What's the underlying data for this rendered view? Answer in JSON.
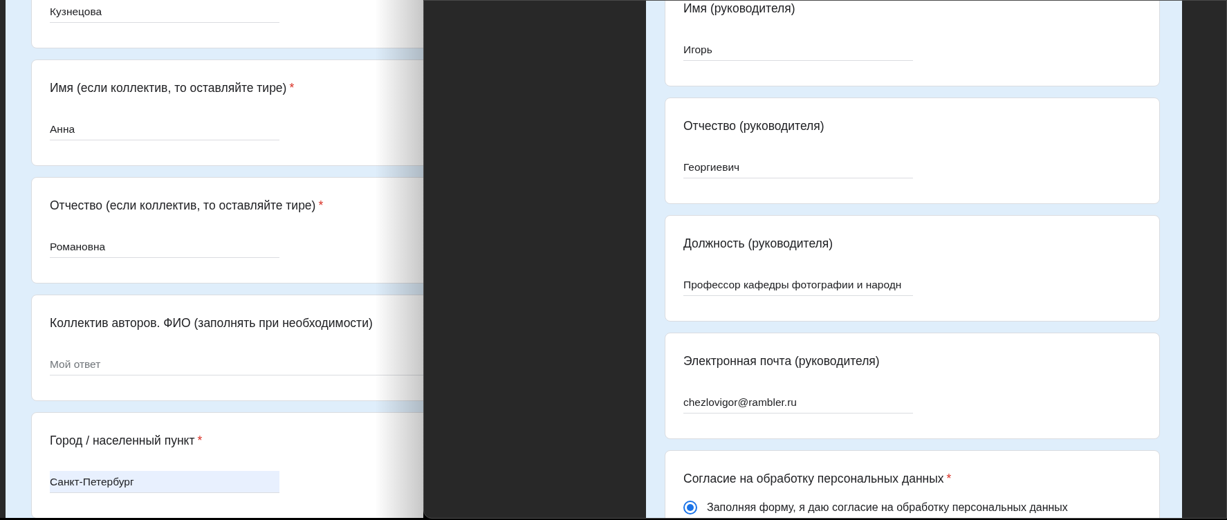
{
  "left_window": {
    "cards": [
      {
        "field": {
          "value": "Кузнецова",
          "highlighted": false
        }
      },
      {
        "question": "Имя (если коллектив, то оставляйте тире)",
        "required_mark": "*",
        "field": {
          "value": "Анна",
          "highlighted": false
        }
      },
      {
        "question": "Отчество (если коллектив, то оставляйте тире)",
        "required_mark": "*",
        "field": {
          "value": "Романовна",
          "highlighted": false
        }
      },
      {
        "question": "Коллектив авторов. ФИО (заполнять при необходимости)",
        "field": {
          "placeholder": "Мой ответ",
          "highlighted": false
        }
      },
      {
        "question": "Город / населенный пункт",
        "required_mark": "*",
        "field": {
          "value": "Санкт-Петербург",
          "highlighted": true
        }
      }
    ]
  },
  "right_window": {
    "cards": [
      {
        "question": "Имя (руководителя)",
        "field": {
          "value": "Игорь",
          "highlighted": false
        }
      },
      {
        "question": "Отчество (руководителя)",
        "field": {
          "value": "Георгиевич",
          "highlighted": false
        }
      },
      {
        "question": "Должность (руководителя)",
        "field": {
          "value": "Профессор кафедры фотографии и народн",
          "highlighted": false
        }
      },
      {
        "question": "Электронная почта (руководителя)",
        "field": {
          "value": "chezlovigor@rambler.ru",
          "highlighted": false
        }
      },
      {
        "question": "Согласие на обработку персональных данных",
        "required_mark": "*",
        "options": [
          {
            "label": "Заполняя форму, я даю согласие на обработку персональных данных",
            "selected": true
          }
        ]
      }
    ]
  }
}
